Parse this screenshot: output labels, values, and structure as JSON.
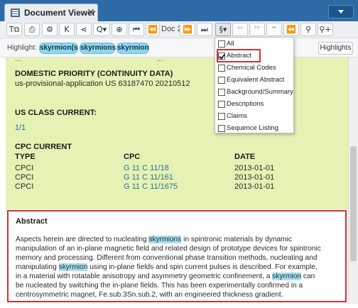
{
  "window": {
    "tab_title": "Document Viewer",
    "close_glyph": "✕",
    "menu_icon": "chevron-down-icon"
  },
  "toolbar": {
    "buttons": [
      {
        "name": "text-size-button",
        "glyph": "T⧉",
        "icon": "text-size-icon"
      },
      {
        "name": "print-button",
        "glyph": "⎙",
        "icon": "print-icon"
      },
      {
        "name": "settings-button",
        "glyph": "⚙",
        "icon": "gear-icon"
      },
      {
        "name": "collapse-button",
        "glyph": "K",
        "icon": "collapse-icon"
      },
      {
        "name": "share-button",
        "glyph": "⋖",
        "icon": "share-icon"
      },
      {
        "name": "search-button",
        "glyph": "Q▾",
        "icon": "search-icon"
      },
      {
        "name": "zoom-button",
        "glyph": "⊕",
        "icon": "zoom-icon"
      },
      {
        "name": "first-doc-button",
        "glyph": "⏮",
        "icon": "first-icon"
      },
      {
        "name": "prev-doc-button",
        "glyph": "⏪",
        "icon": "previous-icon"
      },
      {
        "name": "next-doc-button",
        "glyph": "⏩",
        "icon": "next-icon"
      },
      {
        "name": "last-doc-button",
        "glyph": "⏭",
        "icon": "last-icon"
      },
      {
        "name": "section-button",
        "glyph": "§▾",
        "icon": "section-icon"
      },
      {
        "name": "quote-prev-button",
        "glyph": "❛❛",
        "icon": "quote-icon"
      },
      {
        "name": "quote-next-button",
        "glyph": "❜❜",
        "icon": "quote-icon"
      },
      {
        "name": "quote-all-button",
        "glyph": "❞",
        "icon": "quote-icon"
      },
      {
        "name": "hit-prev-button",
        "glyph": "⏪",
        "icon": "previous-hit-icon"
      },
      {
        "name": "tag-button",
        "glyph": "⚲",
        "icon": "tag-icon"
      },
      {
        "name": "tag-add-button",
        "glyph": "⚲+",
        "icon": "tag-add-icon"
      }
    ],
    "doc_label": "Doc 2"
  },
  "highlight_bar": {
    "label": "Highlight:",
    "terms": [
      "skyrmion(s",
      "skyrmions",
      "skyrmion"
    ],
    "button_label": "Highlights"
  },
  "content": {
    "cut_top_left": "...",
    "cut_top_right": "...",
    "domestic_priority_heading": "DOMESTIC PRIORITY (CONTINUITY DATA)",
    "domestic_priority_value": "us-provisional-application US 63187470 20210512",
    "us_class_heading": "US CLASS CURRENT:",
    "us_class_value": "1/1",
    "cpc_heading": "CPC CURRENT",
    "cpc_columns": [
      "TYPE",
      "CPC",
      "DATE"
    ],
    "cpc_rows": [
      {
        "type": "CPCI",
        "cpc": "G 11 C 11/18",
        "date": "2013-01-01"
      },
      {
        "type": "CPCI",
        "cpc": "G 11 C 11/161",
        "date": "2013-01-01"
      },
      {
        "type": "CPCI",
        "cpc": "G 11 C 11/1675",
        "date": "2013-01-01"
      }
    ]
  },
  "abstract": {
    "title": "Abstract",
    "lines": [
      [
        "Aspects herein are directed to nucleating ",
        "skyrmions",
        " in spintronic materials by dynamic"
      ],
      [
        "manipulation of an in-plane magnetic field and related design of prototype devices for spintronic",
        "",
        ""
      ],
      [
        "memory and processing. Different from conventional phase transition methods, nucleating and",
        "",
        ""
      ],
      [
        "manipulating ",
        "skyrmion",
        " using in-plane fields and spin current pulses is described. For example,"
      ],
      [
        "in a material with rotatable anisotropy and asymmetry geometric confinement, a ",
        "skyrmion",
        " can"
      ],
      [
        "be nucleated by switching the in-plane fields. This has been experimentally confirmed in a",
        "",
        ""
      ],
      [
        "centrosymmetric magnet, Fe.sub.3Sn.sub.2, with an engineered thickness gradient.",
        "",
        ""
      ]
    ]
  },
  "section_menu": {
    "items": [
      {
        "label": "All",
        "checked": false
      },
      {
        "label": "Abstract",
        "checked": true
      },
      {
        "label": "Chemical Codes",
        "checked": false
      },
      {
        "label": "Equivalent Abstract",
        "checked": false
      },
      {
        "label": "Background/Summary",
        "checked": false
      },
      {
        "label": "Descriptions",
        "checked": false
      },
      {
        "label": "Claims",
        "checked": false
      },
      {
        "label": "Sequence Listing",
        "checked": false
      }
    ]
  },
  "colors": {
    "tabbar": "#2e6aa6",
    "content_bg": "#e6f2b4",
    "highlight": "#a6e0f2",
    "annotation_red": "#d62f35",
    "link": "#2a6f97"
  }
}
